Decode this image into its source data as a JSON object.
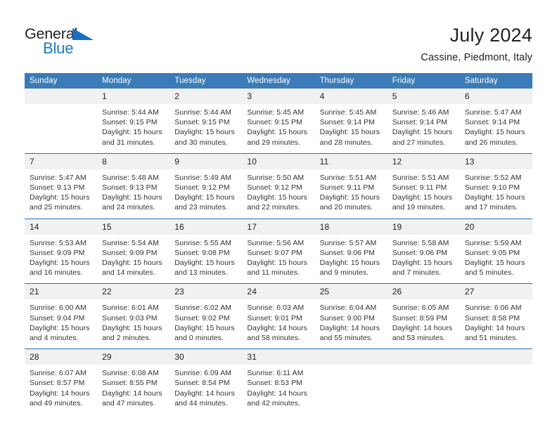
{
  "brand": {
    "name_part1": "General",
    "name_part2": "Blue",
    "triangle_icon": "triangle-icon",
    "accent_color": "#1b7ac9"
  },
  "header": {
    "title": "July 2024",
    "subtitle": "Cassine, Piedmont, Italy"
  },
  "theme": {
    "header_blue": "#3b7cb8",
    "daynum_band": "#f1f1f1",
    "row_rule": "#2f6fa8",
    "text": "#333333"
  },
  "calendar": {
    "weekday_headers": [
      "Sunday",
      "Monday",
      "Tuesday",
      "Wednesday",
      "Thursday",
      "Friday",
      "Saturday"
    ],
    "weeks": [
      {
        "days": [
          {
            "num": "",
            "l1": "",
            "l2": "",
            "l3": "",
            "l4": ""
          },
          {
            "num": "1",
            "l1": "Sunrise: 5:44 AM",
            "l2": "Sunset: 9:15 PM",
            "l3": "Daylight: 15 hours",
            "l4": "and 31 minutes."
          },
          {
            "num": "2",
            "l1": "Sunrise: 5:44 AM",
            "l2": "Sunset: 9:15 PM",
            "l3": "Daylight: 15 hours",
            "l4": "and 30 minutes."
          },
          {
            "num": "3",
            "l1": "Sunrise: 5:45 AM",
            "l2": "Sunset: 9:15 PM",
            "l3": "Daylight: 15 hours",
            "l4": "and 29 minutes."
          },
          {
            "num": "4",
            "l1": "Sunrise: 5:45 AM",
            "l2": "Sunset: 9:14 PM",
            "l3": "Daylight: 15 hours",
            "l4": "and 28 minutes."
          },
          {
            "num": "5",
            "l1": "Sunrise: 5:46 AM",
            "l2": "Sunset: 9:14 PM",
            "l3": "Daylight: 15 hours",
            "l4": "and 27 minutes."
          },
          {
            "num": "6",
            "l1": "Sunrise: 5:47 AM",
            "l2": "Sunset: 9:14 PM",
            "l3": "Daylight: 15 hours",
            "l4": "and 26 minutes."
          }
        ]
      },
      {
        "days": [
          {
            "num": "7",
            "l1": "Sunrise: 5:47 AM",
            "l2": "Sunset: 9:13 PM",
            "l3": "Daylight: 15 hours",
            "l4": "and 25 minutes."
          },
          {
            "num": "8",
            "l1": "Sunrise: 5:48 AM",
            "l2": "Sunset: 9:13 PM",
            "l3": "Daylight: 15 hours",
            "l4": "and 24 minutes."
          },
          {
            "num": "9",
            "l1": "Sunrise: 5:49 AM",
            "l2": "Sunset: 9:12 PM",
            "l3": "Daylight: 15 hours",
            "l4": "and 23 minutes."
          },
          {
            "num": "10",
            "l1": "Sunrise: 5:50 AM",
            "l2": "Sunset: 9:12 PM",
            "l3": "Daylight: 15 hours",
            "l4": "and 22 minutes."
          },
          {
            "num": "11",
            "l1": "Sunrise: 5:51 AM",
            "l2": "Sunset: 9:11 PM",
            "l3": "Daylight: 15 hours",
            "l4": "and 20 minutes."
          },
          {
            "num": "12",
            "l1": "Sunrise: 5:51 AM",
            "l2": "Sunset: 9:11 PM",
            "l3": "Daylight: 15 hours",
            "l4": "and 19 minutes."
          },
          {
            "num": "13",
            "l1": "Sunrise: 5:52 AM",
            "l2": "Sunset: 9:10 PM",
            "l3": "Daylight: 15 hours",
            "l4": "and 17 minutes."
          }
        ]
      },
      {
        "days": [
          {
            "num": "14",
            "l1": "Sunrise: 5:53 AM",
            "l2": "Sunset: 9:09 PM",
            "l3": "Daylight: 15 hours",
            "l4": "and 16 minutes."
          },
          {
            "num": "15",
            "l1": "Sunrise: 5:54 AM",
            "l2": "Sunset: 9:09 PM",
            "l3": "Daylight: 15 hours",
            "l4": "and 14 minutes."
          },
          {
            "num": "16",
            "l1": "Sunrise: 5:55 AM",
            "l2": "Sunset: 9:08 PM",
            "l3": "Daylight: 15 hours",
            "l4": "and 13 minutes."
          },
          {
            "num": "17",
            "l1": "Sunrise: 5:56 AM",
            "l2": "Sunset: 9:07 PM",
            "l3": "Daylight: 15 hours",
            "l4": "and 11 minutes."
          },
          {
            "num": "18",
            "l1": "Sunrise: 5:57 AM",
            "l2": "Sunset: 9:06 PM",
            "l3": "Daylight: 15 hours",
            "l4": "and 9 minutes."
          },
          {
            "num": "19",
            "l1": "Sunrise: 5:58 AM",
            "l2": "Sunset: 9:06 PM",
            "l3": "Daylight: 15 hours",
            "l4": "and 7 minutes."
          },
          {
            "num": "20",
            "l1": "Sunrise: 5:59 AM",
            "l2": "Sunset: 9:05 PM",
            "l3": "Daylight: 15 hours",
            "l4": "and 5 minutes."
          }
        ]
      },
      {
        "days": [
          {
            "num": "21",
            "l1": "Sunrise: 6:00 AM",
            "l2": "Sunset: 9:04 PM",
            "l3": "Daylight: 15 hours",
            "l4": "and 4 minutes."
          },
          {
            "num": "22",
            "l1": "Sunrise: 6:01 AM",
            "l2": "Sunset: 9:03 PM",
            "l3": "Daylight: 15 hours",
            "l4": "and 2 minutes."
          },
          {
            "num": "23",
            "l1": "Sunrise: 6:02 AM",
            "l2": "Sunset: 9:02 PM",
            "l3": "Daylight: 15 hours",
            "l4": "and 0 minutes."
          },
          {
            "num": "24",
            "l1": "Sunrise: 6:03 AM",
            "l2": "Sunset: 9:01 PM",
            "l3": "Daylight: 14 hours",
            "l4": "and 58 minutes."
          },
          {
            "num": "25",
            "l1": "Sunrise: 6:04 AM",
            "l2": "Sunset: 9:00 PM",
            "l3": "Daylight: 14 hours",
            "l4": "and 55 minutes."
          },
          {
            "num": "26",
            "l1": "Sunrise: 6:05 AM",
            "l2": "Sunset: 8:59 PM",
            "l3": "Daylight: 14 hours",
            "l4": "and 53 minutes."
          },
          {
            "num": "27",
            "l1": "Sunrise: 6:06 AM",
            "l2": "Sunset: 8:58 PM",
            "l3": "Daylight: 14 hours",
            "l4": "and 51 minutes."
          }
        ]
      },
      {
        "days": [
          {
            "num": "28",
            "l1": "Sunrise: 6:07 AM",
            "l2": "Sunset: 8:57 PM",
            "l3": "Daylight: 14 hours",
            "l4": "and 49 minutes."
          },
          {
            "num": "29",
            "l1": "Sunrise: 6:08 AM",
            "l2": "Sunset: 8:55 PM",
            "l3": "Daylight: 14 hours",
            "l4": "and 47 minutes."
          },
          {
            "num": "30",
            "l1": "Sunrise: 6:09 AM",
            "l2": "Sunset: 8:54 PM",
            "l3": "Daylight: 14 hours",
            "l4": "and 44 minutes."
          },
          {
            "num": "31",
            "l1": "Sunrise: 6:11 AM",
            "l2": "Sunset: 8:53 PM",
            "l3": "Daylight: 14 hours",
            "l4": "and 42 minutes."
          },
          {
            "num": "",
            "l1": "",
            "l2": "",
            "l3": "",
            "l4": ""
          },
          {
            "num": "",
            "l1": "",
            "l2": "",
            "l3": "",
            "l4": ""
          },
          {
            "num": "",
            "l1": "",
            "l2": "",
            "l3": "",
            "l4": ""
          }
        ]
      }
    ]
  }
}
